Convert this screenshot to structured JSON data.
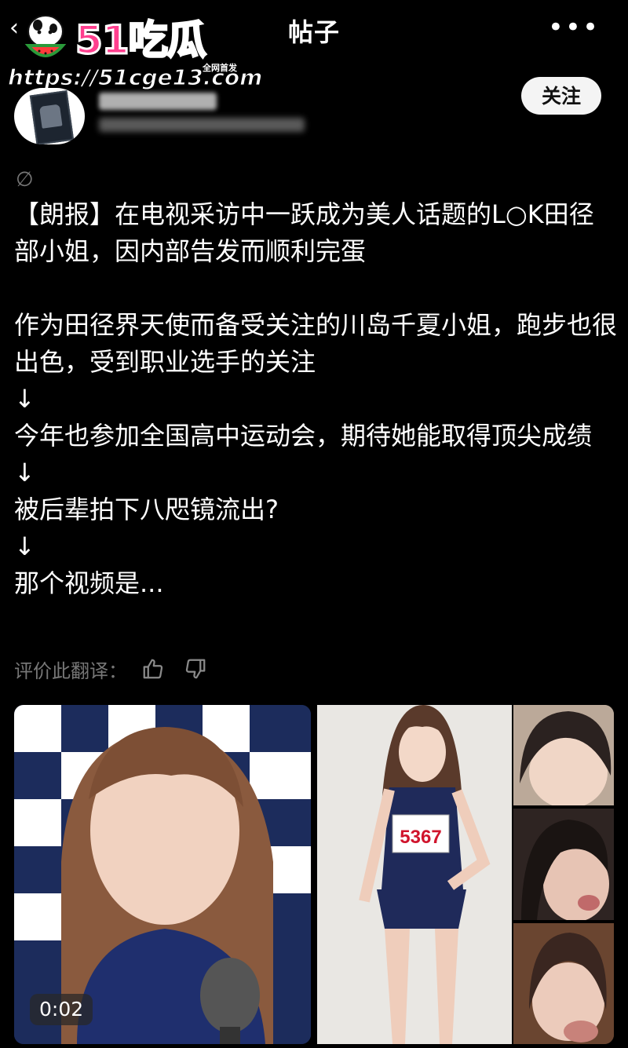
{
  "header": {
    "title": "帖子",
    "more_icon": "more-horizontal-icon",
    "back_icon": "chevron-left-icon"
  },
  "watermark": {
    "brand": "51吃瓜",
    "tagline": "全网首发",
    "url": "https://51cge13.com"
  },
  "profile": {
    "follow_label": "关注"
  },
  "post": {
    "lines": [
      "【朗报】在电视采访中一跃成为美人话题的L○K田径部小姐，因内部告发而顺利完蛋",
      "作为田径界天使而备受关注的川岛千夏小姐，跑步也很出色，受到职业选手的关注",
      "↓",
      "今年也参加全国高中运动会，期待她能取得顶尖成绩",
      "↓",
      "被后辈拍下八咫镜流出?",
      "↓",
      "那个视频是..."
    ]
  },
  "translation_rating": {
    "label": "评价此翻译："
  },
  "media": {
    "video_duration": "0:02",
    "bib_number": "5367"
  },
  "colors": {
    "background": "#000000",
    "brand_pink": "#ff3f8e",
    "muted": "#777777",
    "button_bg": "#f4f4f4"
  }
}
